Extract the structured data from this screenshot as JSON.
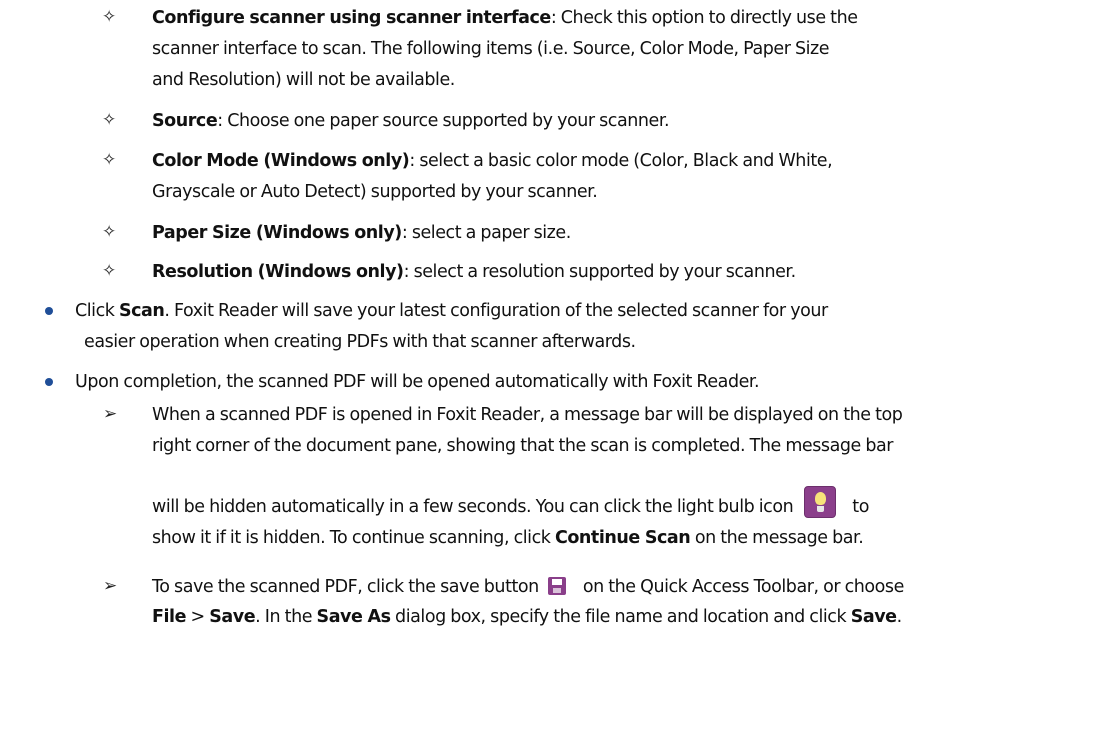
{
  "icons": {
    "diamond": "✧",
    "arrowhead": "➢",
    "bullet_color": "#1f4e98",
    "lightbulb_bg": "#8b3f8b",
    "save_bg": "#8a3f8a"
  },
  "options": [
    {
      "term": "Configure scanner using scanner interface",
      "line1": ": Check this option to directly use the",
      "line2": "scanner interface to scan. The following items (i.e. Source, Color Mode, Paper Size",
      "line3": "and Resolution) will not be available."
    },
    {
      "term": "Source",
      "line1": ": Choose one paper source supported by your scanner."
    },
    {
      "term": "Color Mode (Windows only)",
      "line1": ": select a basic color mode (Color, Black and White,",
      "line2": "Grayscale or Auto Detect) supported by your scanner."
    },
    {
      "term": "Paper Size (Windows only)",
      "line1": ": select a paper size."
    },
    {
      "term": "Resolution (Windows only)",
      "line1": ": select a resolution supported by your scanner."
    }
  ],
  "bullet_scan": {
    "pre": "Click ",
    "scan": "Scan",
    "line1_rest": ". Foxit Reader will save your latest configuration of the selected scanner for your",
    "line2": "easier operation when creating PDFs with that scanner afterwards."
  },
  "bullet_completion": {
    "text": "Upon completion, the scanned PDF will be opened automatically with Foxit Reader."
  },
  "sub_message": {
    "line1": "When a scanned PDF is opened in Foxit Reader, a message bar will be displayed on the top",
    "line2": "right corner of the document pane, showing that the scan is completed. The message bar",
    "line3_pre": "will be hidden automatically in a few seconds. You can click the light bulb icon",
    "line3_post": "to",
    "line4_pre": "show it if it is hidden. To continue scanning, click ",
    "continue_scan": "Continue Scan",
    "line4_post": " on the message bar."
  },
  "sub_save": {
    "line1_pre": "To save the scanned PDF, click the save button",
    "line1_post": "on the Quick Access Toolbar, or choose",
    "file": "File",
    "gt": " > ",
    "save": "Save",
    "mid": ". In the ",
    "save_as": "Save As",
    "line2_rest": " dialog box, specify the file name and location and click ",
    "save2": "Save",
    "end": "."
  }
}
